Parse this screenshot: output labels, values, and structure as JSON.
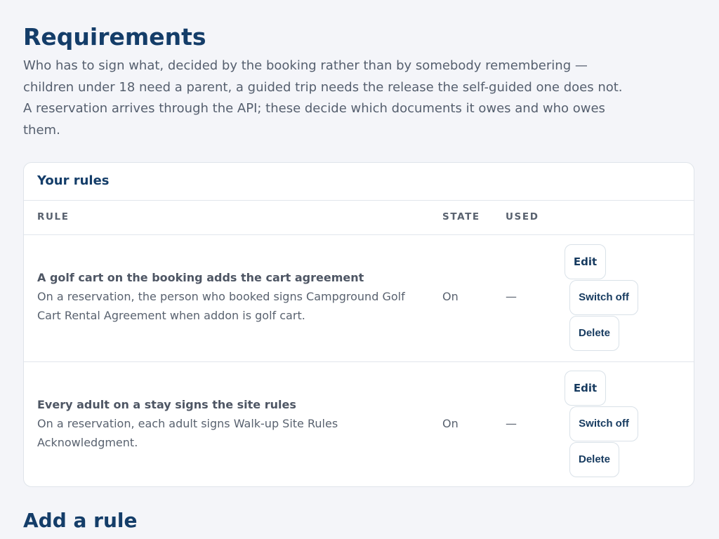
{
  "page": {
    "title": "Requirements",
    "intro": "Who has to sign what, decided by the booking rather than by somebody remembering — children under 18 need a parent, a guided trip needs the release the self-guided one does not. A reservation arrives through the API; these decide which documents it owes and who owes them."
  },
  "rules_card": {
    "title": "Your rules",
    "columns": {
      "rule": "RULE",
      "state": "STATE",
      "used": "USED"
    },
    "rows": [
      {
        "title": "A golf cart on the booking adds the cart agreement",
        "description": "On a reservation, the person who booked signs Campground Golf Cart Rental Agreement when addon is golf cart.",
        "state": "On",
        "used": "—",
        "actions": {
          "edit": "Edit",
          "switch": "Switch off",
          "delete": "Delete"
        }
      },
      {
        "title": "Every adult on a stay signs the site rules",
        "description": "On a reservation, each adult signs Walk-up Site Rules Acknowledgment.",
        "state": "On",
        "used": "—",
        "actions": {
          "edit": "Edit",
          "switch": "Switch off",
          "delete": "Delete"
        }
      }
    ]
  },
  "add_section": {
    "title": "Add a rule"
  },
  "colors": {
    "heading": "#143d69",
    "background": "#f4f5f9",
    "card": "#ffffff",
    "button_text": "#163a5f"
  }
}
